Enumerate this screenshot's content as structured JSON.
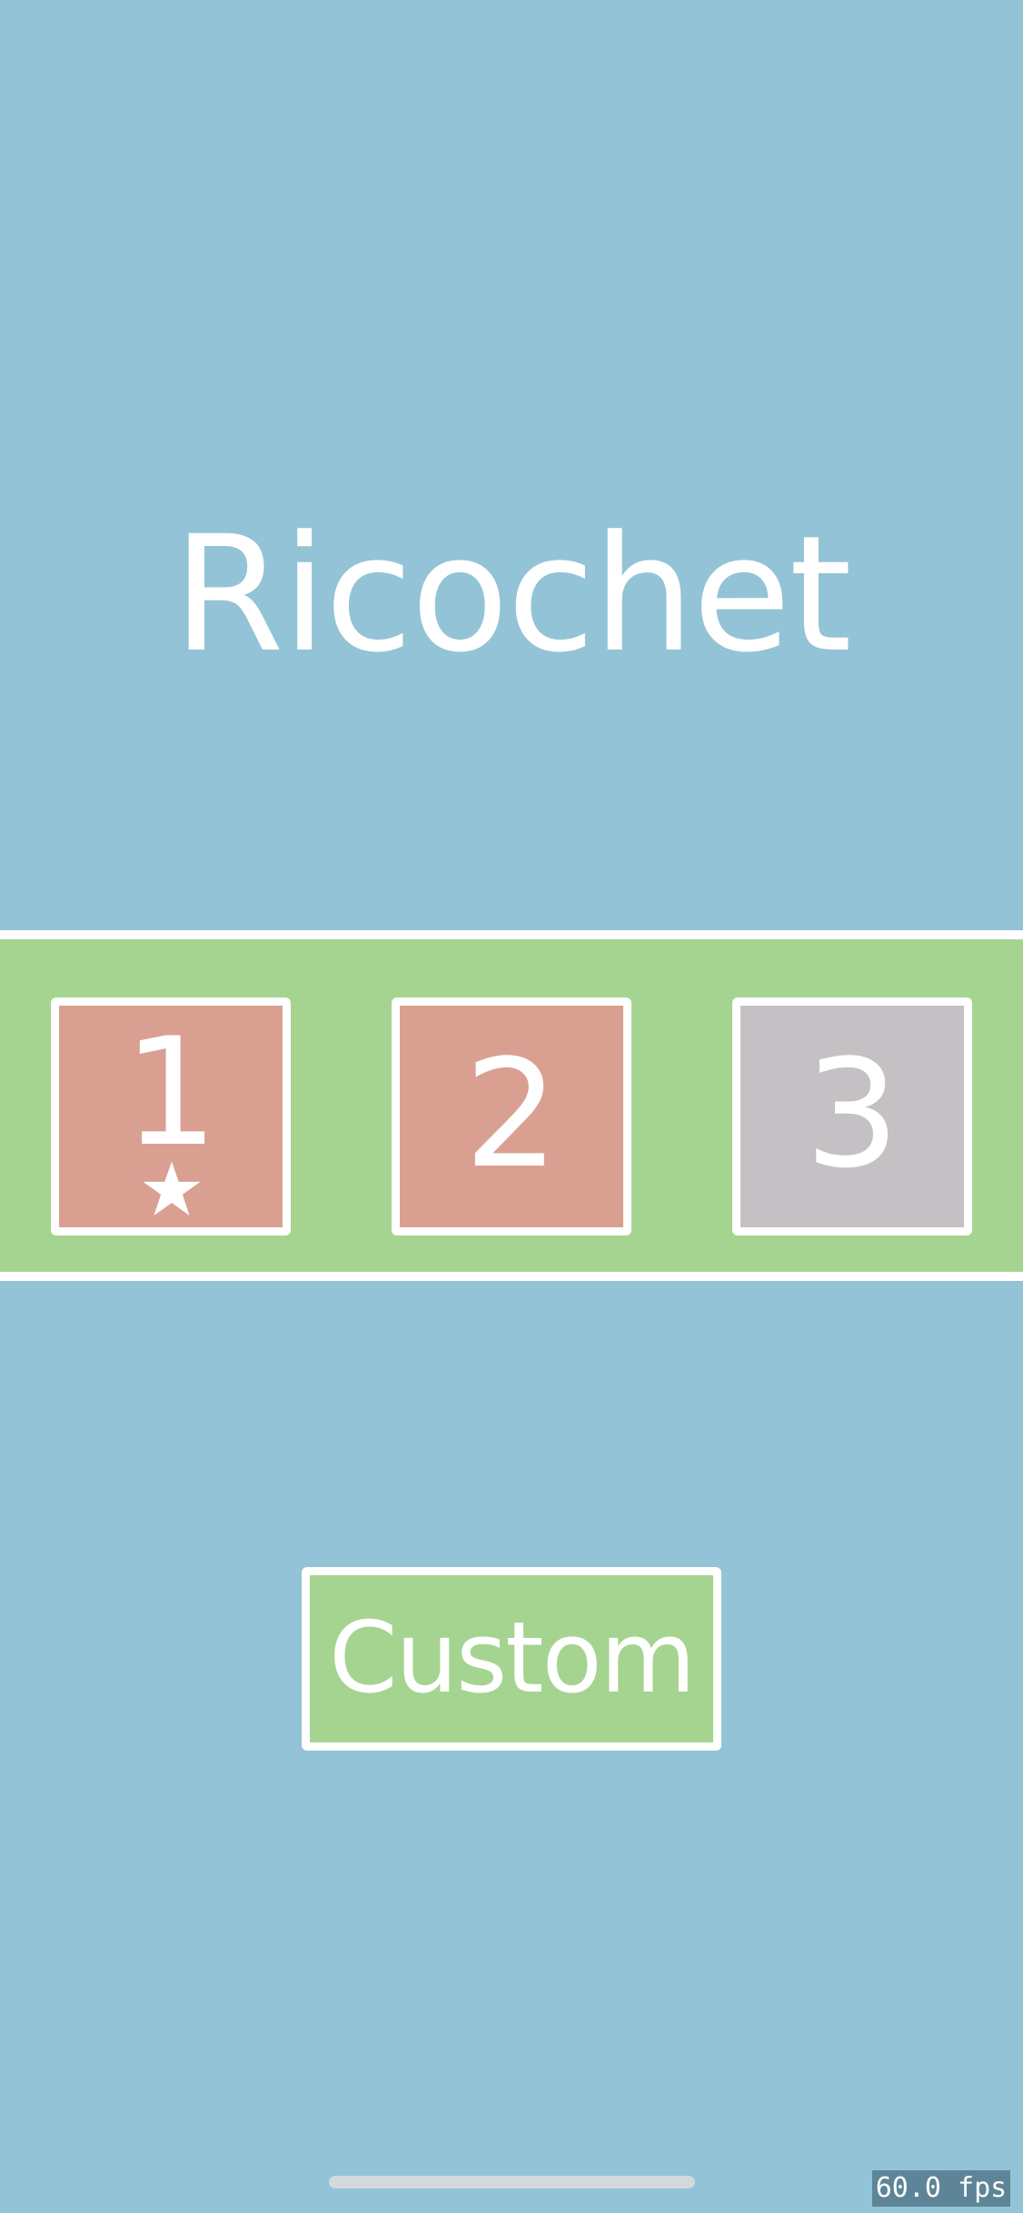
{
  "title": "Ricochet",
  "levels": [
    {
      "label": "1",
      "color": "#d9a092",
      "starred": true,
      "icon": "star-icon"
    },
    {
      "label": "2",
      "color": "#d9a092",
      "starred": false
    },
    {
      "label": "3",
      "color": "#c4c0c4",
      "starred": false
    }
  ],
  "custom_button": {
    "label": "Custom",
    "color": "#a5d491"
  },
  "fps_counter": "60.0 fps",
  "colors": {
    "background": "#93c3d7",
    "band": "#a5d491",
    "border": "#ffffff",
    "completed_tile": "#d9a092",
    "locked_tile": "#c4c0c4"
  }
}
